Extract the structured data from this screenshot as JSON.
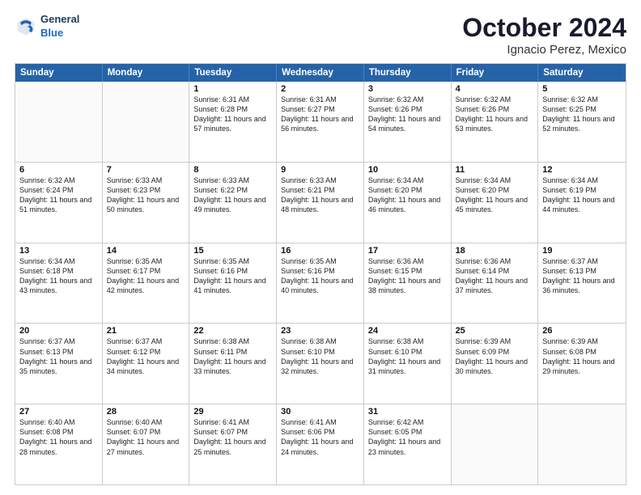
{
  "logo": {
    "line1": "General",
    "line2": "Blue"
  },
  "title": "October 2024",
  "subtitle": "Ignacio Perez, Mexico",
  "header_days": [
    "Sunday",
    "Monday",
    "Tuesday",
    "Wednesday",
    "Thursday",
    "Friday",
    "Saturday"
  ],
  "weeks": [
    [
      {
        "day": "",
        "text": ""
      },
      {
        "day": "",
        "text": ""
      },
      {
        "day": "1",
        "text": "Sunrise: 6:31 AM\nSunset: 6:28 PM\nDaylight: 11 hours and 57 minutes."
      },
      {
        "day": "2",
        "text": "Sunrise: 6:31 AM\nSunset: 6:27 PM\nDaylight: 11 hours and 56 minutes."
      },
      {
        "day": "3",
        "text": "Sunrise: 6:32 AM\nSunset: 6:26 PM\nDaylight: 11 hours and 54 minutes."
      },
      {
        "day": "4",
        "text": "Sunrise: 6:32 AM\nSunset: 6:26 PM\nDaylight: 11 hours and 53 minutes."
      },
      {
        "day": "5",
        "text": "Sunrise: 6:32 AM\nSunset: 6:25 PM\nDaylight: 11 hours and 52 minutes."
      }
    ],
    [
      {
        "day": "6",
        "text": "Sunrise: 6:32 AM\nSunset: 6:24 PM\nDaylight: 11 hours and 51 minutes."
      },
      {
        "day": "7",
        "text": "Sunrise: 6:33 AM\nSunset: 6:23 PM\nDaylight: 11 hours and 50 minutes."
      },
      {
        "day": "8",
        "text": "Sunrise: 6:33 AM\nSunset: 6:22 PM\nDaylight: 11 hours and 49 minutes."
      },
      {
        "day": "9",
        "text": "Sunrise: 6:33 AM\nSunset: 6:21 PM\nDaylight: 11 hours and 48 minutes."
      },
      {
        "day": "10",
        "text": "Sunrise: 6:34 AM\nSunset: 6:20 PM\nDaylight: 11 hours and 46 minutes."
      },
      {
        "day": "11",
        "text": "Sunrise: 6:34 AM\nSunset: 6:20 PM\nDaylight: 11 hours and 45 minutes."
      },
      {
        "day": "12",
        "text": "Sunrise: 6:34 AM\nSunset: 6:19 PM\nDaylight: 11 hours and 44 minutes."
      }
    ],
    [
      {
        "day": "13",
        "text": "Sunrise: 6:34 AM\nSunset: 6:18 PM\nDaylight: 11 hours and 43 minutes."
      },
      {
        "day": "14",
        "text": "Sunrise: 6:35 AM\nSunset: 6:17 PM\nDaylight: 11 hours and 42 minutes."
      },
      {
        "day": "15",
        "text": "Sunrise: 6:35 AM\nSunset: 6:16 PM\nDaylight: 11 hours and 41 minutes."
      },
      {
        "day": "16",
        "text": "Sunrise: 6:35 AM\nSunset: 6:16 PM\nDaylight: 11 hours and 40 minutes."
      },
      {
        "day": "17",
        "text": "Sunrise: 6:36 AM\nSunset: 6:15 PM\nDaylight: 11 hours and 38 minutes."
      },
      {
        "day": "18",
        "text": "Sunrise: 6:36 AM\nSunset: 6:14 PM\nDaylight: 11 hours and 37 minutes."
      },
      {
        "day": "19",
        "text": "Sunrise: 6:37 AM\nSunset: 6:13 PM\nDaylight: 11 hours and 36 minutes."
      }
    ],
    [
      {
        "day": "20",
        "text": "Sunrise: 6:37 AM\nSunset: 6:13 PM\nDaylight: 11 hours and 35 minutes."
      },
      {
        "day": "21",
        "text": "Sunrise: 6:37 AM\nSunset: 6:12 PM\nDaylight: 11 hours and 34 minutes."
      },
      {
        "day": "22",
        "text": "Sunrise: 6:38 AM\nSunset: 6:11 PM\nDaylight: 11 hours and 33 minutes."
      },
      {
        "day": "23",
        "text": "Sunrise: 6:38 AM\nSunset: 6:10 PM\nDaylight: 11 hours and 32 minutes."
      },
      {
        "day": "24",
        "text": "Sunrise: 6:38 AM\nSunset: 6:10 PM\nDaylight: 11 hours and 31 minutes."
      },
      {
        "day": "25",
        "text": "Sunrise: 6:39 AM\nSunset: 6:09 PM\nDaylight: 11 hours and 30 minutes."
      },
      {
        "day": "26",
        "text": "Sunrise: 6:39 AM\nSunset: 6:08 PM\nDaylight: 11 hours and 29 minutes."
      }
    ],
    [
      {
        "day": "27",
        "text": "Sunrise: 6:40 AM\nSunset: 6:08 PM\nDaylight: 11 hours and 28 minutes."
      },
      {
        "day": "28",
        "text": "Sunrise: 6:40 AM\nSunset: 6:07 PM\nDaylight: 11 hours and 27 minutes."
      },
      {
        "day": "29",
        "text": "Sunrise: 6:41 AM\nSunset: 6:07 PM\nDaylight: 11 hours and 25 minutes."
      },
      {
        "day": "30",
        "text": "Sunrise: 6:41 AM\nSunset: 6:06 PM\nDaylight: 11 hours and 24 minutes."
      },
      {
        "day": "31",
        "text": "Sunrise: 6:42 AM\nSunset: 6:05 PM\nDaylight: 11 hours and 23 minutes."
      },
      {
        "day": "",
        "text": ""
      },
      {
        "day": "",
        "text": ""
      }
    ]
  ]
}
